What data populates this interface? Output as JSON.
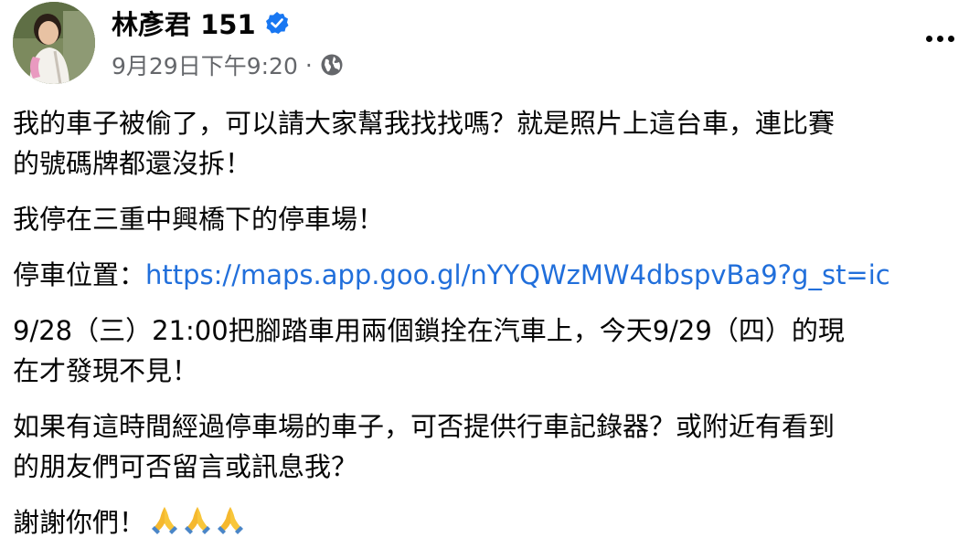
{
  "post": {
    "author": "林彥君 151",
    "timestamp": "9月29日下午9:20",
    "separator": "·",
    "privacy_icon": "globe-icon",
    "verified_icon": "verified-badge-icon",
    "more_icon": "more-options-icon"
  },
  "body": {
    "p1_line1": "我的車子被偷了，可以請大家幫我找找嗎？就是照片上這台車，連比賽",
    "p1_line2": "的號碼牌都還沒拆！",
    "p2": "我停在三重中興橋下的停車場！",
    "p3_label": "停車位置：",
    "p3_link": "https://maps.app.goo.gl/nYYQWzMW4dbspvBa9?g_st=ic",
    "p4_line1": "9/28（三）21:00把腳踏車用兩個鎖拴在汽車上，今天9/29（四）的現",
    "p4_line2": "在才發現不見！",
    "p5_line1": "如果有這時間經過停車場的車子，可否提供行車記錄器？或附近有看到",
    "p5_line2": "的朋友們可否留言或訊息我？",
    "p6": "謝謝你們！",
    "p6_emoji": "folded-hands-icon"
  },
  "colors": {
    "text": "#050505",
    "meta": "#65676b",
    "link": "#216fdb",
    "verified": "#1877f2"
  }
}
